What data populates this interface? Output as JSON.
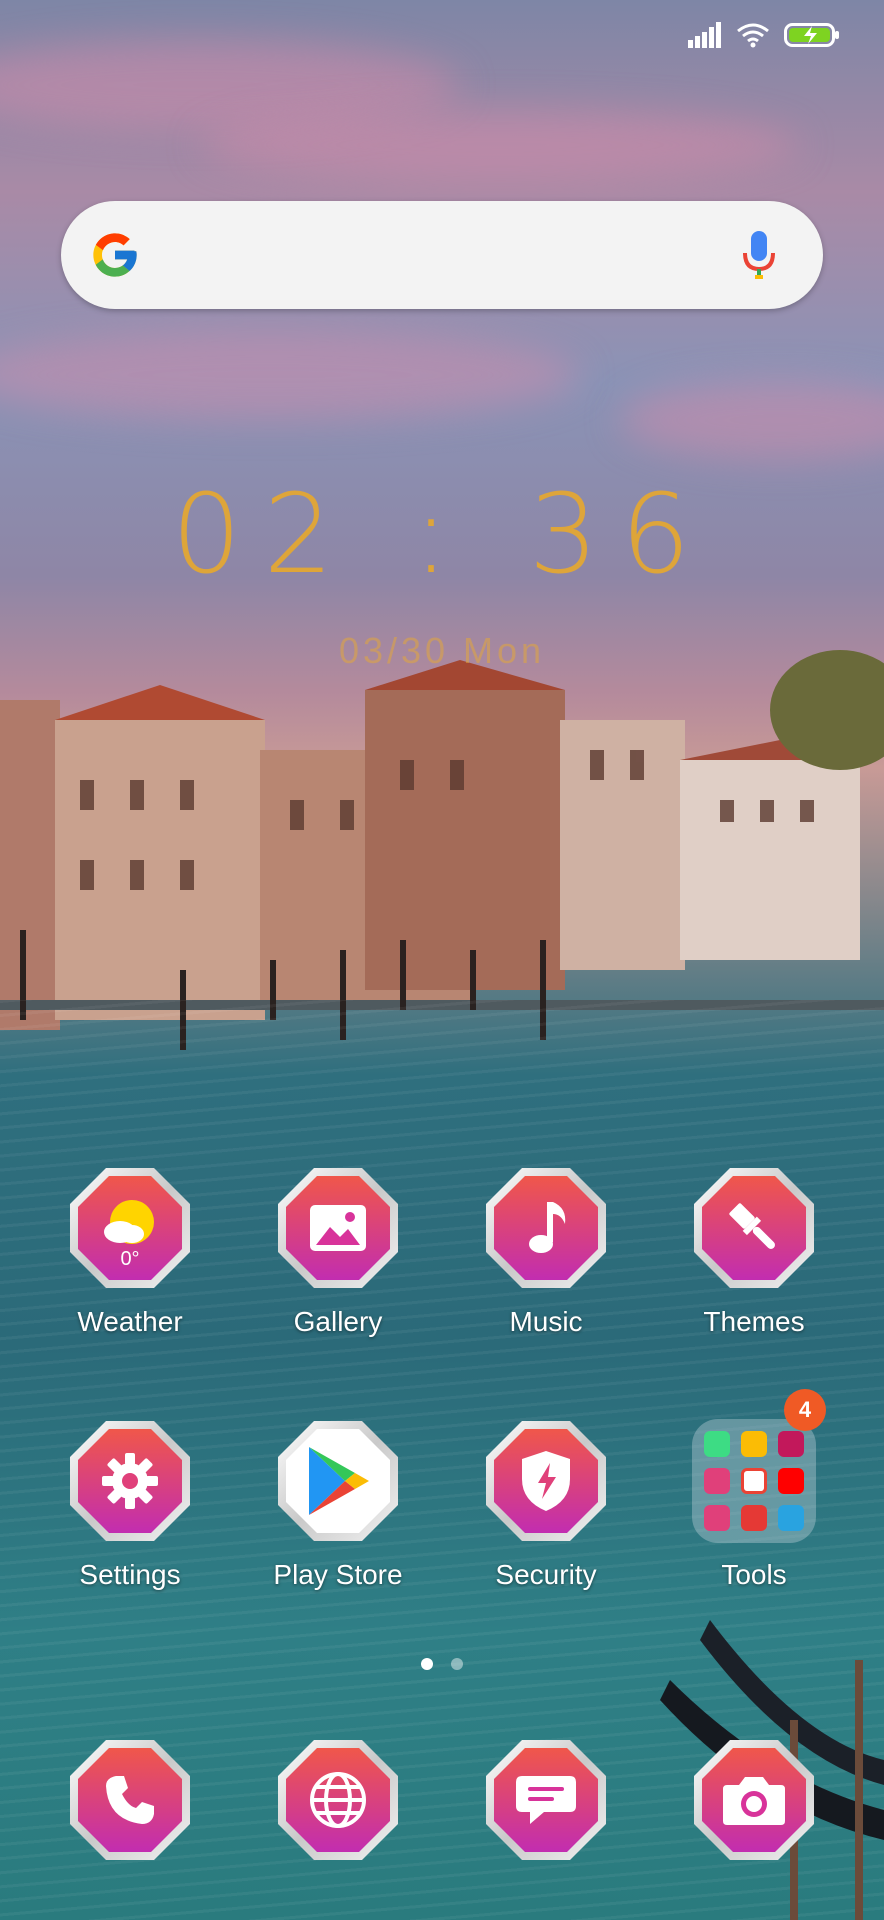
{
  "status_bar": {
    "signal_icon": "signal-icon",
    "wifi_icon": "wifi-icon",
    "battery_icon": "battery-charging-icon"
  },
  "search_bar": {
    "logo": "google-logo-icon",
    "mic": "mic-icon"
  },
  "clock": {
    "time": "02 : 36",
    "date": "03/30 Mon"
  },
  "apps": [
    {
      "label": "Weather",
      "icon": "weather-icon",
      "temp": "0°"
    },
    {
      "label": "Gallery",
      "icon": "gallery-icon"
    },
    {
      "label": "Music",
      "icon": "music-note-icon"
    },
    {
      "label": "Themes",
      "icon": "paintbrush-icon"
    },
    {
      "label": "Settings",
      "icon": "gear-icon"
    },
    {
      "label": "Play Store",
      "icon": "play-store-icon"
    },
    {
      "label": "Security",
      "icon": "shield-icon"
    },
    {
      "label": "Tools",
      "icon": "folder-icon",
      "badge": "4"
    }
  ],
  "dock": [
    {
      "icon": "phone-icon"
    },
    {
      "icon": "browser-globe-icon"
    },
    {
      "icon": "messages-icon"
    },
    {
      "icon": "camera-icon"
    }
  ],
  "page_indicator": {
    "pages": 2,
    "current": 1
  },
  "colors": {
    "accent": "#e3a734",
    "icon_gradient_top": "#f0574a",
    "icon_gradient_bottom": "#c22db0",
    "badge": "#f05a25"
  }
}
